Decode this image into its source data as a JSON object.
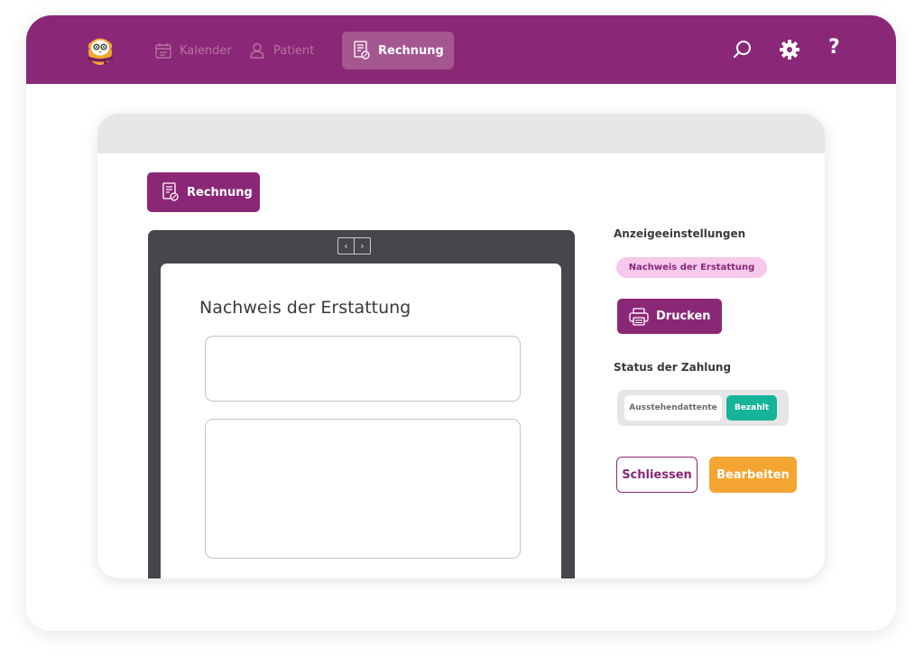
{
  "nav": {
    "kalender": {
      "label": "Kalender",
      "icon": "calendar-icon"
    },
    "patient": {
      "label": "Patient",
      "icon": "user-icon"
    },
    "rechnung": {
      "label": "Rechnung",
      "icon": "invoice-icon",
      "active": true
    }
  },
  "header_actions": {
    "search_icon": "search-icon",
    "settings_icon": "gear-icon",
    "help_label": "?"
  },
  "card": {
    "rechnung_button_label": "Rechnung",
    "document": {
      "title": "Nachweis der Erstattung",
      "pager_prev": "‹",
      "pager_next": "›"
    },
    "display_settings": {
      "label": "Anzeigeeinstellungen",
      "selected_chip": "Nachweis der Erstattung",
      "print_label": "Drucken"
    },
    "payment_status": {
      "label": "Status der Zahlung",
      "pending_label": "Ausstehendattente",
      "paid_label": "Bezahlt",
      "selected": "Bezahlt"
    },
    "actions": {
      "close_label": "Schliessen",
      "edit_label": "Bearbeiten"
    }
  },
  "colors": {
    "brand_purple": "#8a2877",
    "active_tab": "#a4568f",
    "chip_pink": "#f5c8ec",
    "paid_green": "#15b39a",
    "edit_orange": "#f4a531",
    "viewer_dark": "#46464c"
  }
}
